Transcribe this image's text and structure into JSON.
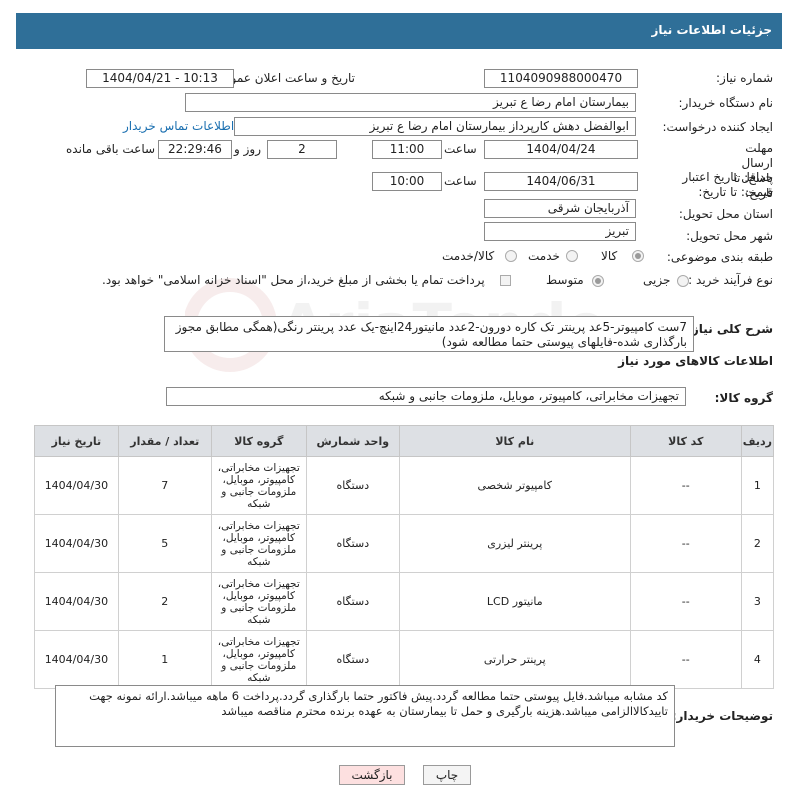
{
  "header": {
    "title": "جزئیات اطلاعات نیاز"
  },
  "need_number": {
    "label": "شماره نیاز:",
    "value": "1104090988000470"
  },
  "announce": {
    "label": "تاریخ و ساعت اعلان عمومی:",
    "value": "1404/04/21 - 10:13"
  },
  "buyer_org": {
    "label": "نام دستگاه خریدار:",
    "value": "بیمارستان امام رضا  ع  تبریز"
  },
  "requester": {
    "label": "ایجاد کننده درخواست:",
    "value": "ابوالفضل دهش کارپرداز بیمارستان امام رضا  ع  تبریز",
    "contact_link": "اطلاعات تماس خریدار"
  },
  "deadline": {
    "label": "مهلت ارسال پاسخ: تا تاریخ:",
    "date": "1404/04/24",
    "time_label": "ساعت",
    "time": "11:00",
    "days": "2",
    "days_label": "روز و",
    "remaining": "22:29:46",
    "remaining_label": "ساعت باقی مانده"
  },
  "validity": {
    "label": "حداقل تاریخ اعتبار قیمت: تا تاریخ:",
    "date": "1404/06/31",
    "time_label": "ساعت",
    "time": "10:00"
  },
  "province": {
    "label": "استان محل تحویل:",
    "value": "آذربایجان شرقی"
  },
  "city": {
    "label": "شهر محل تحویل:",
    "value": "تبریز"
  },
  "category": {
    "label": "طبقه بندی موضوعی:",
    "options": [
      "کالا",
      "خدمت",
      "کالا/خدمت"
    ]
  },
  "process": {
    "label": "نوع فرآیند خرید :",
    "options": [
      "جزیی",
      "متوسط"
    ],
    "note": "پرداخت تمام یا بخشی از مبلغ خرید،از محل \"اسناد خزانه اسلامی\" خواهد بود."
  },
  "general_desc": {
    "label": "شرح کلی نیاز:",
    "value": "7ست کامپیوتر-5عد پرینتر تک کاره دورون-2عدد مانیتور24اینچ-یک عدد پرینتر رنگی(همگی مطابق مجوز بارگذاری شده-فایلهای پیوستی حتما مطالعه شود)"
  },
  "goods_info": {
    "title": "اطلاعات کالاهای مورد نیاز"
  },
  "goods_group": {
    "label": "گروه کالا:",
    "value": "تجهیزات مخابراتی، کامپیوتر، موبایل، ملزومات جانبی و شبکه"
  },
  "table": {
    "headers": [
      "ردیف",
      "کد کالا",
      "نام کالا",
      "واحد شمارش",
      "گروه کالا",
      "تعداد / مقدار",
      "تاریخ نیاز"
    ],
    "rows": [
      {
        "idx": "1",
        "code": "--",
        "name": "کامپیوتر شخصی",
        "unit": "دستگاه",
        "group": "تجهیزات مخابراتی، کامپیوتر، موبایل، ملزومات جانبی و شبکه",
        "qty": "7",
        "date": "1404/04/30"
      },
      {
        "idx": "2",
        "code": "--",
        "name": "پرینتر لیزری",
        "unit": "دستگاه",
        "group": "تجهیزات مخابراتی، کامپیوتر، موبایل، ملزومات جانبی و شبکه",
        "qty": "5",
        "date": "1404/04/30"
      },
      {
        "idx": "3",
        "code": "--",
        "name": "مانیتور LCD",
        "unit": "دستگاه",
        "group": "تجهیزات مخابراتی، کامپیوتر، موبایل، ملزومات جانبی و شبکه",
        "qty": "2",
        "date": "1404/04/30"
      },
      {
        "idx": "4",
        "code": "--",
        "name": "پرینتر حرارتی",
        "unit": "دستگاه",
        "group": "تجهیزات مخابراتی، کامپیوتر، موبایل، ملزومات جانبی و شبکه",
        "qty": "1",
        "date": "1404/04/30"
      }
    ]
  },
  "buyer_notes": {
    "label": "توضیحات خریدار:",
    "value": "کد مشابه میباشد.فایل پیوستی حتما مطالعه گردد.پیش فاکتور حتما بارگذاری گردد.پرداخت 6 ماهه میباشد.ارائه نمونه جهت تاییدکالاالزامی میباشد.هزینه بارگیری و حمل تا بیمارستان به عهده برنده محترم مناقصه میباشد"
  },
  "buttons": {
    "print": "چاپ",
    "back": "بازگشت"
  },
  "watermark": "AriaTender.neT"
}
